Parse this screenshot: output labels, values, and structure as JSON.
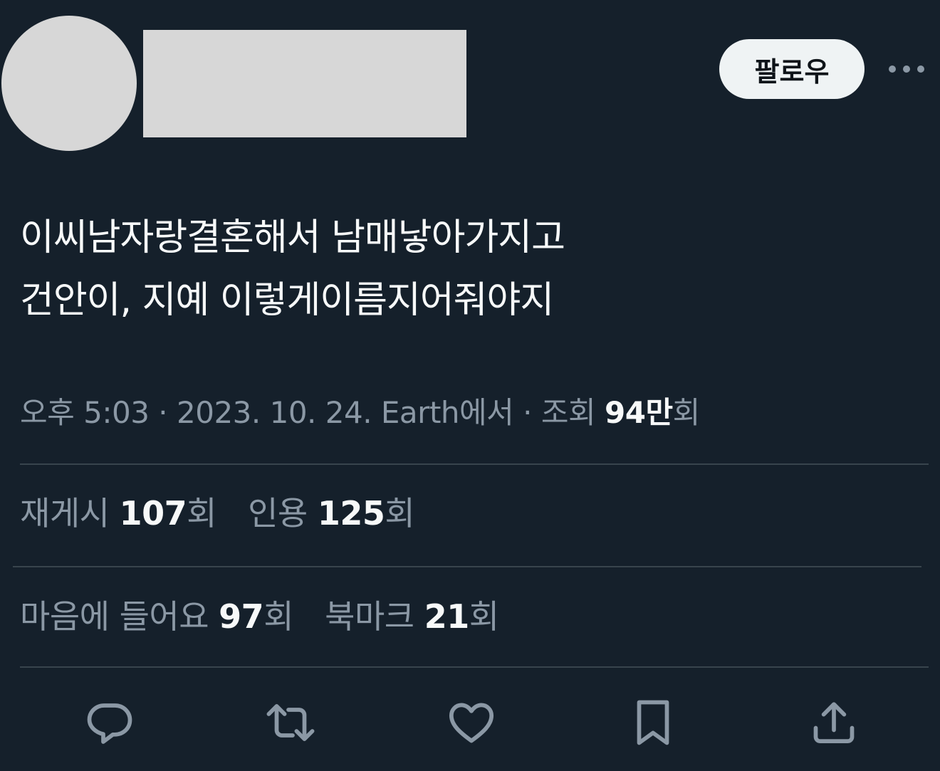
{
  "header": {
    "follow_label": "팔로우"
  },
  "tweet": {
    "lines": [
      "이씨남자랑결혼해서 남매낳아가지고",
      "건안이, 지예 이렇게이름지어줘야지"
    ],
    "meta": {
      "time": "오후 5:03",
      "sep1": " · ",
      "date": "2023. 10. 24.",
      "source": " Earth에서",
      "sep2": " · ",
      "views_label": "조회 ",
      "views_num": "94만",
      "views_unit": "회"
    }
  },
  "stats": {
    "repost_label": "재게시 ",
    "repost_num": "107",
    "repost_unit": "회",
    "quote_label": "인용 ",
    "quote_num": "125",
    "quote_unit": "회",
    "like_label": "마음에 들어요 ",
    "like_num": "97",
    "like_unit": "회",
    "bookmark_label": "북마크 ",
    "bookmark_num": "21",
    "bookmark_unit": "회"
  },
  "icons": {
    "reply": "reply-icon",
    "retweet": "retweet-icon",
    "like": "heart-icon",
    "bookmark": "bookmark-icon",
    "share": "share-icon",
    "more": "more-icon"
  },
  "colors": {
    "background": "#15202b",
    "text": "#f7f9f9",
    "muted": "#8b98a5",
    "divider": "#38444d",
    "follow_bg": "#eff3f4"
  }
}
